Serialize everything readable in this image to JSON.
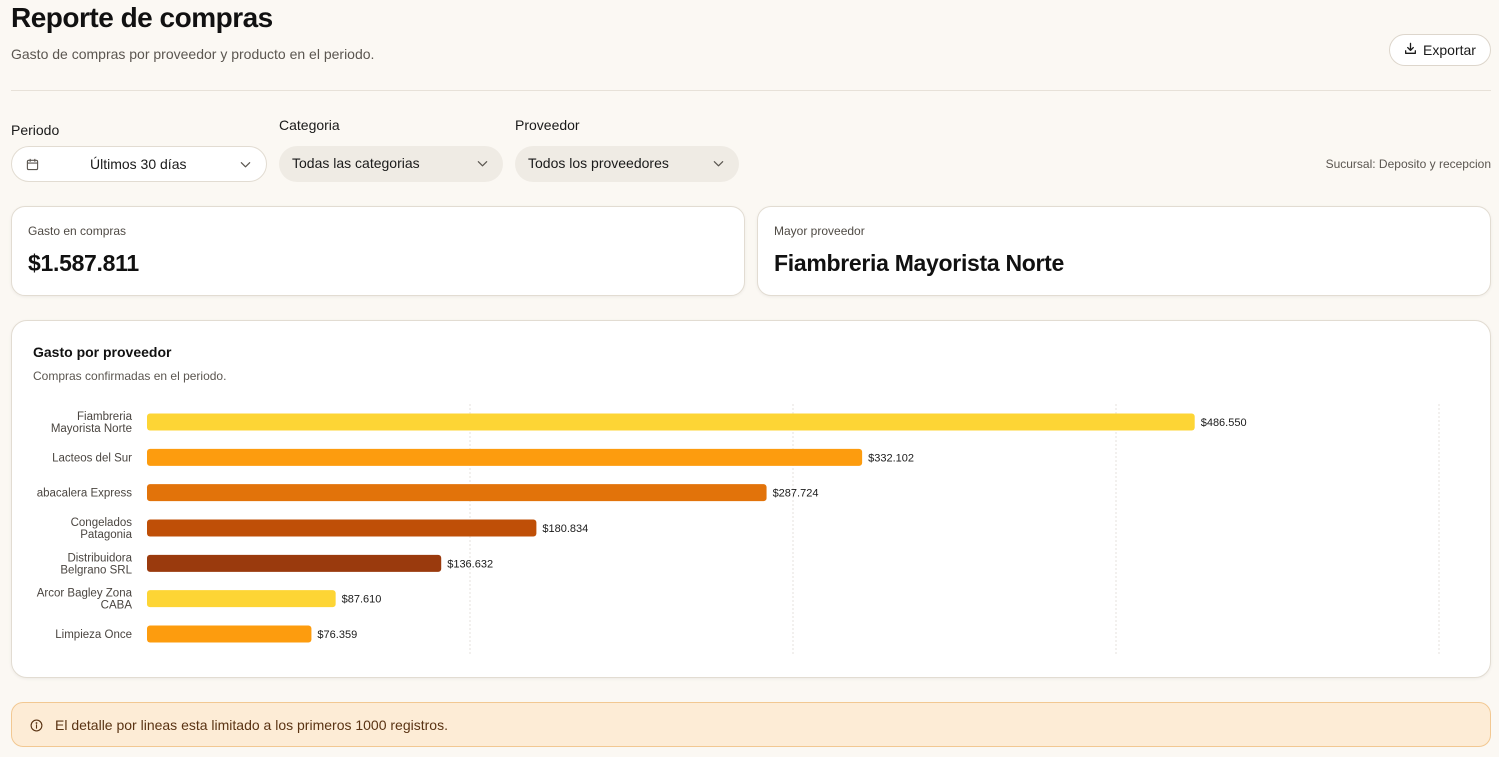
{
  "header": {
    "title": "Reporte de compras",
    "subtitle": "Gasto de compras por proveedor y producto en el periodo.",
    "export_label": "Exportar"
  },
  "filters": {
    "period": {
      "label": "Periodo",
      "value": "Últimos 30 días",
      "icon": "calendar-icon"
    },
    "category": {
      "label": "Categoria",
      "value": "Todas las categorias"
    },
    "supplier": {
      "label": "Proveedor",
      "value": "Todos los proveedores"
    },
    "branch": "Sucursal: Deposito y recepcion"
  },
  "kpis": {
    "spend": {
      "label": "Gasto en compras",
      "value": "$1.587.811"
    },
    "top_supplier": {
      "label": "Mayor proveedor",
      "value": "Fiambreria Mayorista Norte"
    }
  },
  "chart_card": {
    "title": "Gasto por proveedor",
    "subtitle": "Compras confirmadas en el periodo."
  },
  "chart_data": {
    "type": "bar",
    "orientation": "horizontal",
    "categories": [
      [
        "Fiambreria",
        "Mayorista Norte"
      ],
      [
        "Lacteos del Sur"
      ],
      [
        "abacalera Express"
      ],
      [
        "Congelados",
        "Patagonia"
      ],
      [
        "Distribuidora",
        "Belgrano SRL"
      ],
      [
        "Arcor Bagley Zona",
        "CABA"
      ],
      [
        "Limpieza Once"
      ]
    ],
    "values": [
      486550,
      332102,
      287724,
      180834,
      136632,
      87610,
      76359
    ],
    "value_labels": [
      "$486.550",
      "$332.102",
      "$287.724",
      "$180.834",
      "$136.632",
      "$87.610",
      "$76.359"
    ],
    "colors": [
      "#fdd535",
      "#fd9c0e",
      "#e2730a",
      "#bf4f07",
      "#9a3a0d",
      "#fdd535",
      "#fd9c0e"
    ],
    "xlim": [
      0,
      600000
    ],
    "grid": true
  },
  "notice": {
    "text": "El detalle por lineas esta limitado a los primeros 1000 registros.",
    "icon": "info-icon"
  }
}
